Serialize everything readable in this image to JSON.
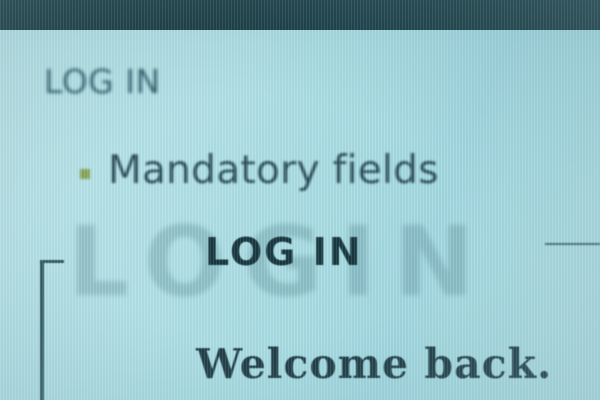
{
  "nav": {
    "login_label": "LOG IN",
    "arrow_icon": "play-arrow-icon"
  },
  "form_note": {
    "text": "Mandatory fields",
    "bullet_color": "#8aa55a"
  },
  "login_panel": {
    "watermark": "LOGIN",
    "title": "LOG IN",
    "welcome": "Welcome back."
  },
  "colors": {
    "background": "#aee0e6",
    "top_bar": "#13343c",
    "text_dark": "#183840"
  }
}
